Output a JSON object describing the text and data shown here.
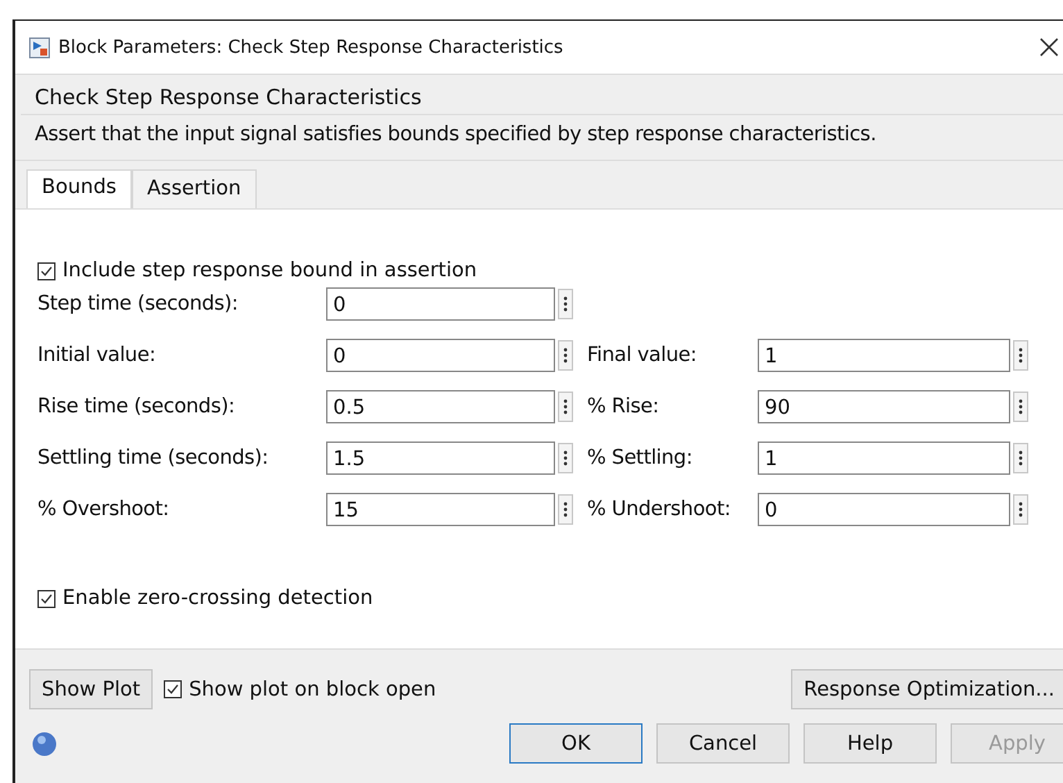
{
  "window": {
    "title": "Block Parameters: Check Step Response Characteristics"
  },
  "block_name": "Check Step Response Characteristics",
  "description": "Assert that the input signal satisfies bounds specified by step response characteristics.",
  "tabs": [
    {
      "label": "Bounds",
      "selected": true
    },
    {
      "label": "Assertion",
      "selected": false
    }
  ],
  "include_bound": {
    "label": "Include step response bound in assertion",
    "checked": true
  },
  "rows": [
    {
      "fields": [
        {
          "label": "Step time (seconds):",
          "value": "0"
        }
      ]
    },
    {
      "fields": [
        {
          "label": "Initial value:",
          "value": "0"
        },
        {
          "label": "Final value:",
          "value": "1"
        }
      ]
    },
    {
      "fields": [
        {
          "label": "Rise time (seconds):",
          "value": "0.5"
        },
        {
          "label": "% Rise:",
          "value": "90"
        }
      ]
    },
    {
      "fields": [
        {
          "label": "Settling time (seconds):",
          "value": "1.5"
        },
        {
          "label": "% Settling:",
          "value": "1"
        }
      ]
    },
    {
      "fields": [
        {
          "label": "% Overshoot:",
          "value": "15"
        },
        {
          "label": "% Undershoot:",
          "value": "0"
        }
      ]
    }
  ],
  "zero_crossing": {
    "label": "Enable zero-crossing detection",
    "checked": true
  },
  "show_plot_button": "Show Plot",
  "show_plot_on_open": {
    "label": "Show plot on block open",
    "checked": true
  },
  "response_optimization_button": "Response Optimization...",
  "buttons": [
    {
      "label": "OK",
      "kind": "default",
      "disabled": false
    },
    {
      "label": "Cancel",
      "kind": "normal",
      "disabled": false
    },
    {
      "label": "Help",
      "kind": "normal",
      "disabled": false
    },
    {
      "label": "Apply",
      "kind": "normal",
      "disabled": true
    }
  ]
}
